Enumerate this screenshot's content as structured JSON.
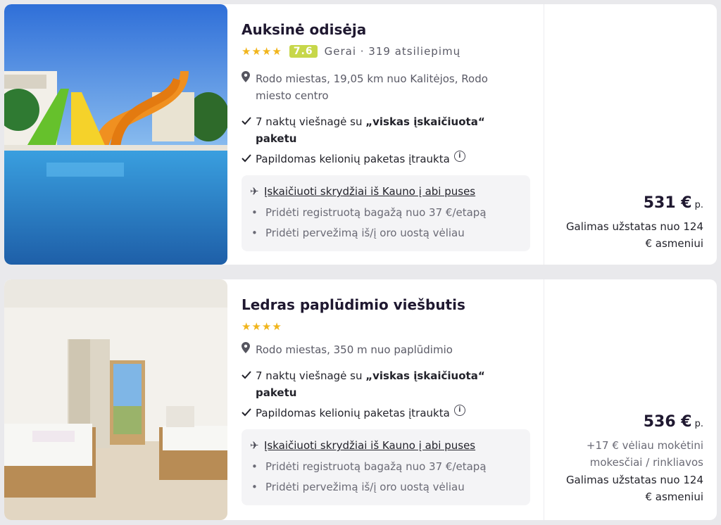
{
  "hotels": [
    {
      "name": "Auksinė odisėja",
      "stars": "★★★★",
      "rating_score": "7.6",
      "rating_label": "Gerai · 319 atsiliepimų",
      "location_lines": [
        "Rodo miestas, 19,05 km nuo Kalitėjos, Rodo",
        "miesto centro"
      ],
      "stay_prefix": "7 naktų viešnagė su ",
      "stay_bold_1": "„viskas įskaičiuota“",
      "stay_bold_2": "paketu",
      "package_text": "Papildomas kelionių paketas įtraukta",
      "flight_text": "Įskaičiuoti skrydžiai iš Kauno į abi puses",
      "addon_1": "Pridėti registruotą bagažą nuo 37 €/etapą",
      "addon_2": "Pridėti pervežimą iš/į oro uostą vėliau",
      "price": "531 €",
      "price_unit": "p.",
      "deposit_line_1": "Galimas užstatas nuo 124",
      "deposit_line_2": "€ asmeniui"
    },
    {
      "name": "Ledras paplūdimio viešbutis",
      "stars": "★★★★",
      "location_lines": [
        "Rodo miestas, 350 m nuo paplūdimio"
      ],
      "stay_prefix": "7 naktų viešnagė su ",
      "stay_bold_1": "„viskas įskaičiuota“",
      "stay_bold_2": "paketu",
      "package_text": "Papildomas kelionių paketas įtraukta",
      "flight_text": "Įskaičiuoti skrydžiai iš Kauno į abi puses",
      "addon_1": "Pridėti registruotą bagažą nuo 37 €/etapą",
      "addon_2": "Pridėti pervežimą iš/į oro uostą vėliau",
      "price": "536 €",
      "price_unit": "p.",
      "fee_line_1": "+17 € vėliau mokėtini",
      "fee_line_2": "mokesčiai / rinkliavos",
      "deposit_line_1": "Galimas užstatas nuo 124",
      "deposit_line_2": "€ asmeniui"
    }
  ],
  "icons": {
    "location": "map-pin-icon",
    "check": "check-icon",
    "info": "info-circle-icon",
    "flight": "airplane-icon"
  },
  "colors": {
    "rating_badge": "#c7d74a",
    "stars": "#f1b51c"
  }
}
